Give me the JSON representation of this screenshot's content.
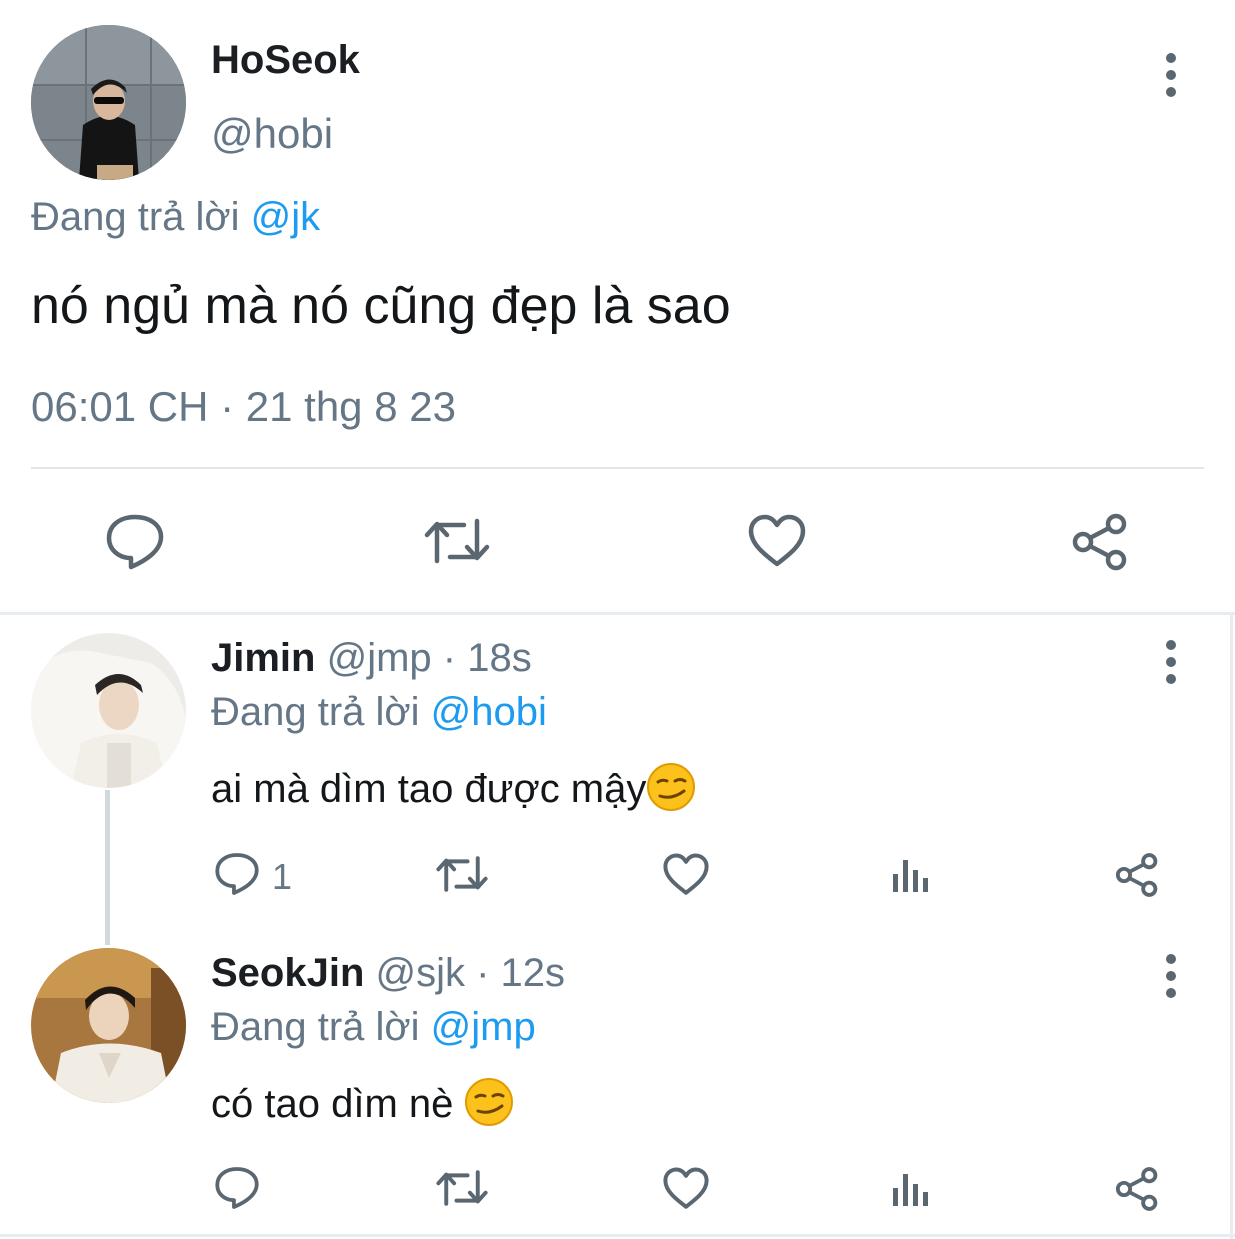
{
  "main_tweet": {
    "name": "HoSeok",
    "handle": "@hobi",
    "reply_prefix": "Đang trả lời ",
    "reply_to": "@jk",
    "text": "nó ngủ mà nó cũng đẹp là sao",
    "timestamp": "06:01 CH · 21 thg 8 23",
    "actions": [
      "reply-icon",
      "retweet-icon",
      "like-icon",
      "share-icon"
    ]
  },
  "replies": [
    {
      "name": "Jimin",
      "meta": " @jmp · 18s",
      "reply_prefix": "Đang trả lời ",
      "reply_to": "@hobi",
      "text": "ai mà dìm tao được mậy",
      "reply_count": "1",
      "emoji": "smirk-emoji"
    },
    {
      "name": "SeokJin",
      "meta": " @sjk · 12s",
      "reply_prefix": "Đang trả lời ",
      "reply_to": "@jmp",
      "text": "có tao dìm nè ",
      "reply_count": "",
      "emoji": "smirk-emoji"
    }
  ],
  "colors": {
    "mention": "#1d9bf0",
    "muted": "#657786",
    "icon": "#5b6770"
  }
}
